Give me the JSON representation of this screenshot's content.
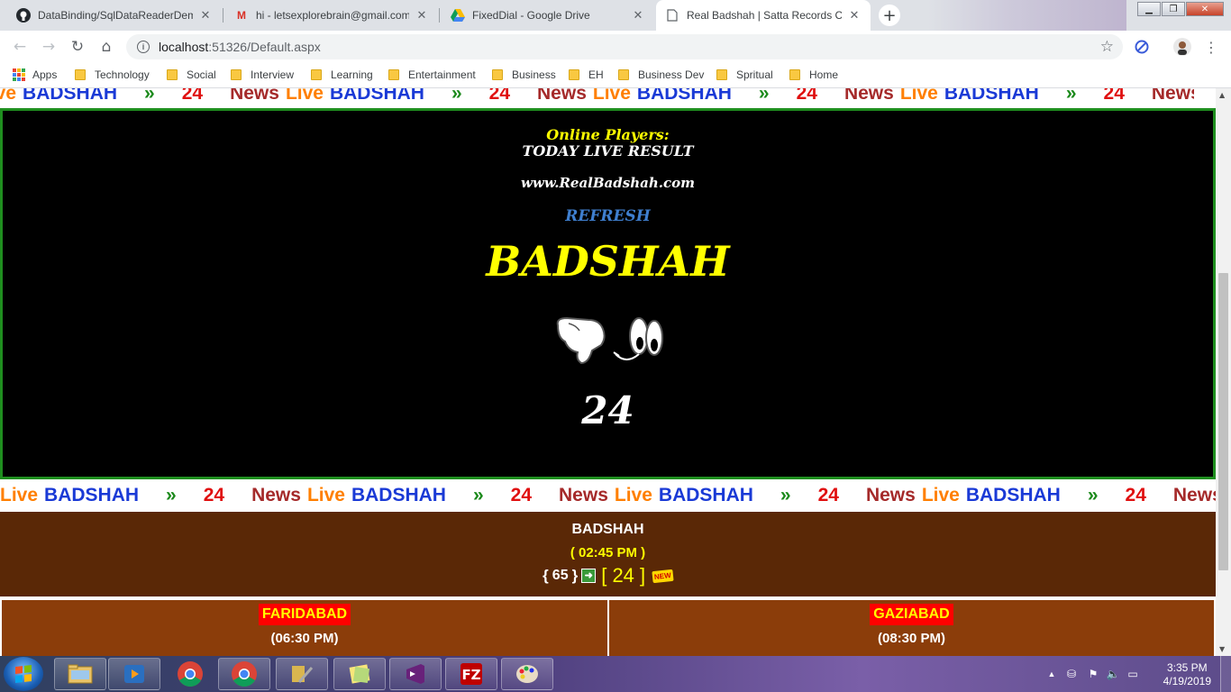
{
  "browser": {
    "tabs": [
      {
        "title": "DataBinding/SqlDataReaderDem",
        "icon": "github-icon",
        "active": false
      },
      {
        "title": "hi - letsexplorebrain@gmail.com",
        "icon": "gmail-icon",
        "active": false
      },
      {
        "title": "FixedDial - Google Drive",
        "icon": "drive-icon",
        "active": false
      },
      {
        "title": "Real Badshah | Satta Records Cha",
        "icon": "page-icon",
        "active": true
      }
    ],
    "url_host": "localhost",
    "url_path": ":51326/Default.aspx",
    "bookmarks": [
      "Apps",
      "Technology",
      "Social",
      "Interview",
      "Learning",
      "Entertainment",
      "Business",
      "EH",
      "Business Dev",
      "Spritual",
      "Home"
    ]
  },
  "marquee": {
    "news": "News",
    "live": "Live",
    "badshah": "BADSHAH",
    "separator": "»",
    "number": "24"
  },
  "hero": {
    "online_players": "Online Players:",
    "today_live": "TODAY LIVE RESULT",
    "website": "www.RealBadshah.com",
    "refresh": "REFRESH",
    "game_name": "BADSHAH",
    "result": "24"
  },
  "result_band": {
    "name": "BADSHAH",
    "time": "( 02:45 PM )",
    "prev_open": "{",
    "prev_value": "65",
    "prev_close": "}",
    "current": "[ 24 ]",
    "new_badge": "NEW"
  },
  "cities": [
    {
      "name": "FARIDABAD",
      "time": "(06:30 PM)"
    },
    {
      "name": "GAZIABAD",
      "time": "(08:30 PM)"
    }
  ],
  "taskbar": {
    "time": "3:35 PM",
    "date": "4/19/2019"
  },
  "colors": {
    "hero_yellow": "#ffff00",
    "refresh_blue": "#3f7fcf",
    "band_brown": "#5a2806",
    "city_brown": "#8b3d0a",
    "city_label_red": "#ff0000",
    "border_green": "#1f8f1f"
  }
}
